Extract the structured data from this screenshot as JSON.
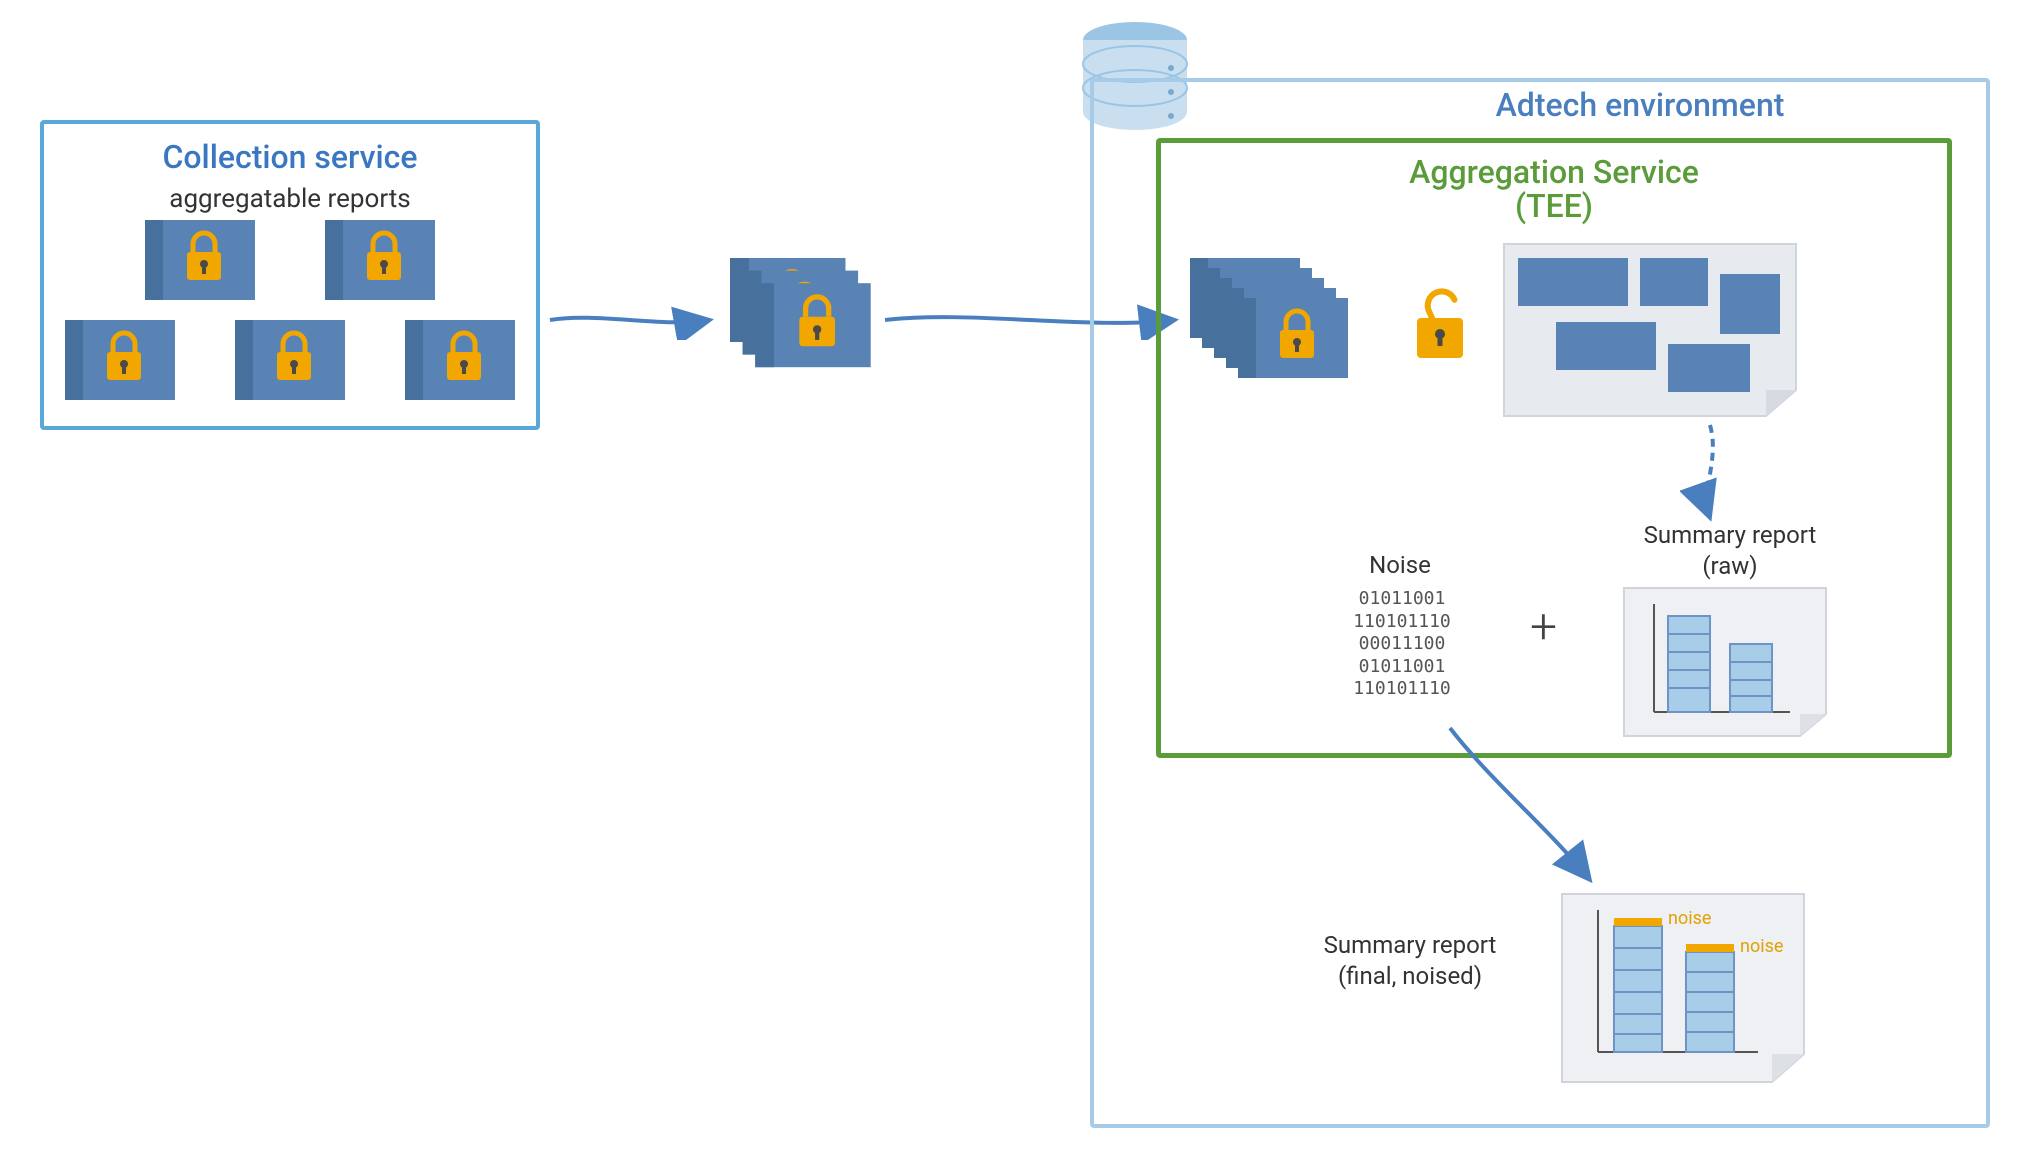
{
  "collection": {
    "title": "Collection service",
    "subtitle": "aggregatable reports"
  },
  "adtech": {
    "title": "Adtech environment"
  },
  "aggregation": {
    "title": "Aggregation Service",
    "subtitle_paren": "(TEE)"
  },
  "noise": {
    "label": "Noise",
    "bits": [
      "01011001",
      "110101110",
      "00011100",
      "01011001",
      "110101110"
    ],
    "tag": "noise",
    "plus": "+"
  },
  "summary_raw": {
    "line1": "Summary report",
    "line2": "(raw)"
  },
  "summary_final": {
    "line1": "Summary report",
    "line2": "(final, noised)"
  },
  "colors": {
    "collection_border": "#5aa8d9",
    "collection_title": "#3a77c2",
    "adtech_border": "#a5cbe8",
    "adtech_title": "#4a7fbf",
    "aggregation_border": "#5b9c3a",
    "aggregation_title": "#5b9c3a",
    "report_fill": "#5a83b5",
    "lock_fill": "#f2a600",
    "db_top": "#9bc5e5",
    "db_body": "#c9dff0",
    "arrow": "#4a7fbf",
    "bar_fill": "#a8cde8",
    "bar_stripe": "#6c94c4",
    "noise_bar": "#f2a600"
  }
}
